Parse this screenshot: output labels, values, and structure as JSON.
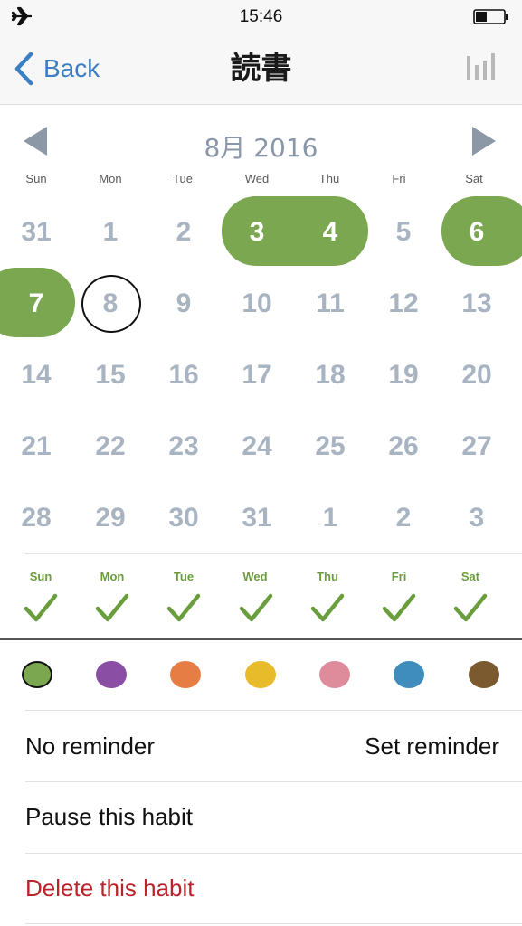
{
  "status_bar": {
    "time": "15:46"
  },
  "nav": {
    "back_label": "Back",
    "title": "読書"
  },
  "calendar": {
    "month_label": "8月 2016",
    "weekdays": [
      "Sun",
      "Mon",
      "Tue",
      "Wed",
      "Thu",
      "Fri",
      "Sat"
    ],
    "weeks": [
      [
        "31",
        "1",
        "2",
        "3",
        "4",
        "5",
        "6"
      ],
      [
        "7",
        "8",
        "9",
        "10",
        "11",
        "12",
        "13"
      ],
      [
        "14",
        "15",
        "16",
        "17",
        "18",
        "19",
        "20"
      ],
      [
        "21",
        "22",
        "23",
        "24",
        "25",
        "26",
        "27"
      ],
      [
        "28",
        "29",
        "30",
        "31",
        "1",
        "2",
        "3"
      ]
    ],
    "completed_days": [
      "3",
      "4",
      "6",
      "7"
    ],
    "today": "8"
  },
  "week_checks": {
    "days": [
      "Sun",
      "Mon",
      "Tue",
      "Wed",
      "Thu",
      "Fri",
      "Sat"
    ],
    "checked": [
      true,
      true,
      true,
      true,
      true,
      true,
      true
    ]
  },
  "colors": {
    "options": [
      "#7aa74f",
      "#8a4fa4",
      "#e57d45",
      "#e8bb2a",
      "#de8b9c",
      "#3f8dbd",
      "#7a5a2e"
    ],
    "selected_index": 0
  },
  "settings": {
    "reminder_status": "No reminder",
    "set_reminder_label": "Set reminder",
    "pause_label": "Pause this habit",
    "delete_label": "Delete this habit"
  },
  "theme": {
    "accent": "#7aa74f",
    "link": "#3a7fc4",
    "danger": "#b8242a"
  }
}
